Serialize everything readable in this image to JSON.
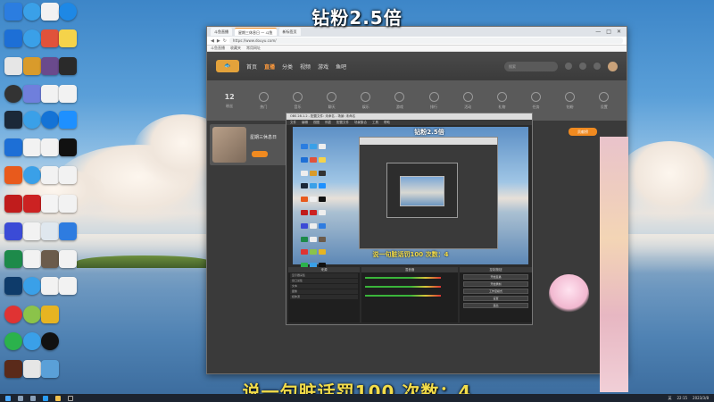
{
  "overlay": {
    "top_caption": "钻粉2.5倍",
    "bottom_caption": "说一句脏话罚100 次数：4"
  },
  "browser": {
    "tabs": [
      "斗鱼直播",
      "星期三休息日 — 斗鱼",
      "新标签页"
    ],
    "window_controls": [
      "—",
      "□",
      "✕"
    ],
    "address": "https://www.douyu.com/",
    "bookmarks": [
      "斗鱼直播",
      "收藏夹",
      "常用网址"
    ]
  },
  "site": {
    "nav": [
      "首页",
      "直播",
      "分类",
      "视频",
      "游戏",
      "鱼吧"
    ],
    "search_placeholder": "搜索",
    "categories": [
      {
        "label": "粉丝"
      },
      {
        "label": "热门"
      },
      {
        "label": "音乐"
      },
      {
        "label": "聊天"
      },
      {
        "label": "娱乐"
      },
      {
        "label": "游戏"
      },
      {
        "label": "排行"
      },
      {
        "label": "活动"
      },
      {
        "label": "礼物"
      },
      {
        "label": "任务"
      },
      {
        "label": "钻粉"
      },
      {
        "label": "设置"
      }
    ],
    "fans_count": "12",
    "streamer_name": "星期三休息日",
    "gift_tab": "贡献榜"
  },
  "obs": {
    "title": "OBS 28.1.2 - 配置文件: 未命名 - 场景: 未命名",
    "menu": [
      "文件",
      "编辑",
      "视图",
      "停靠",
      "配置文件",
      "场景集合",
      "工具",
      "帮助"
    ],
    "nested_top_caption": "钻粉2.5倍",
    "nested_bottom_caption": "说一句脏话罚100 次数：4",
    "docks": {
      "sources_title": "来源",
      "mixer_title": "混音器",
      "controls_title": "控制按钮"
    },
    "sources": [
      "显示器采集",
      "窗口采集",
      "文本",
      "图像",
      "媒体源"
    ],
    "controls": [
      "开始直播",
      "开始录制",
      "工作室模式",
      "设置",
      "退出"
    ]
  },
  "taskbar": {
    "clock": "22:15",
    "date": "2023/3/8",
    "lang": "英"
  }
}
